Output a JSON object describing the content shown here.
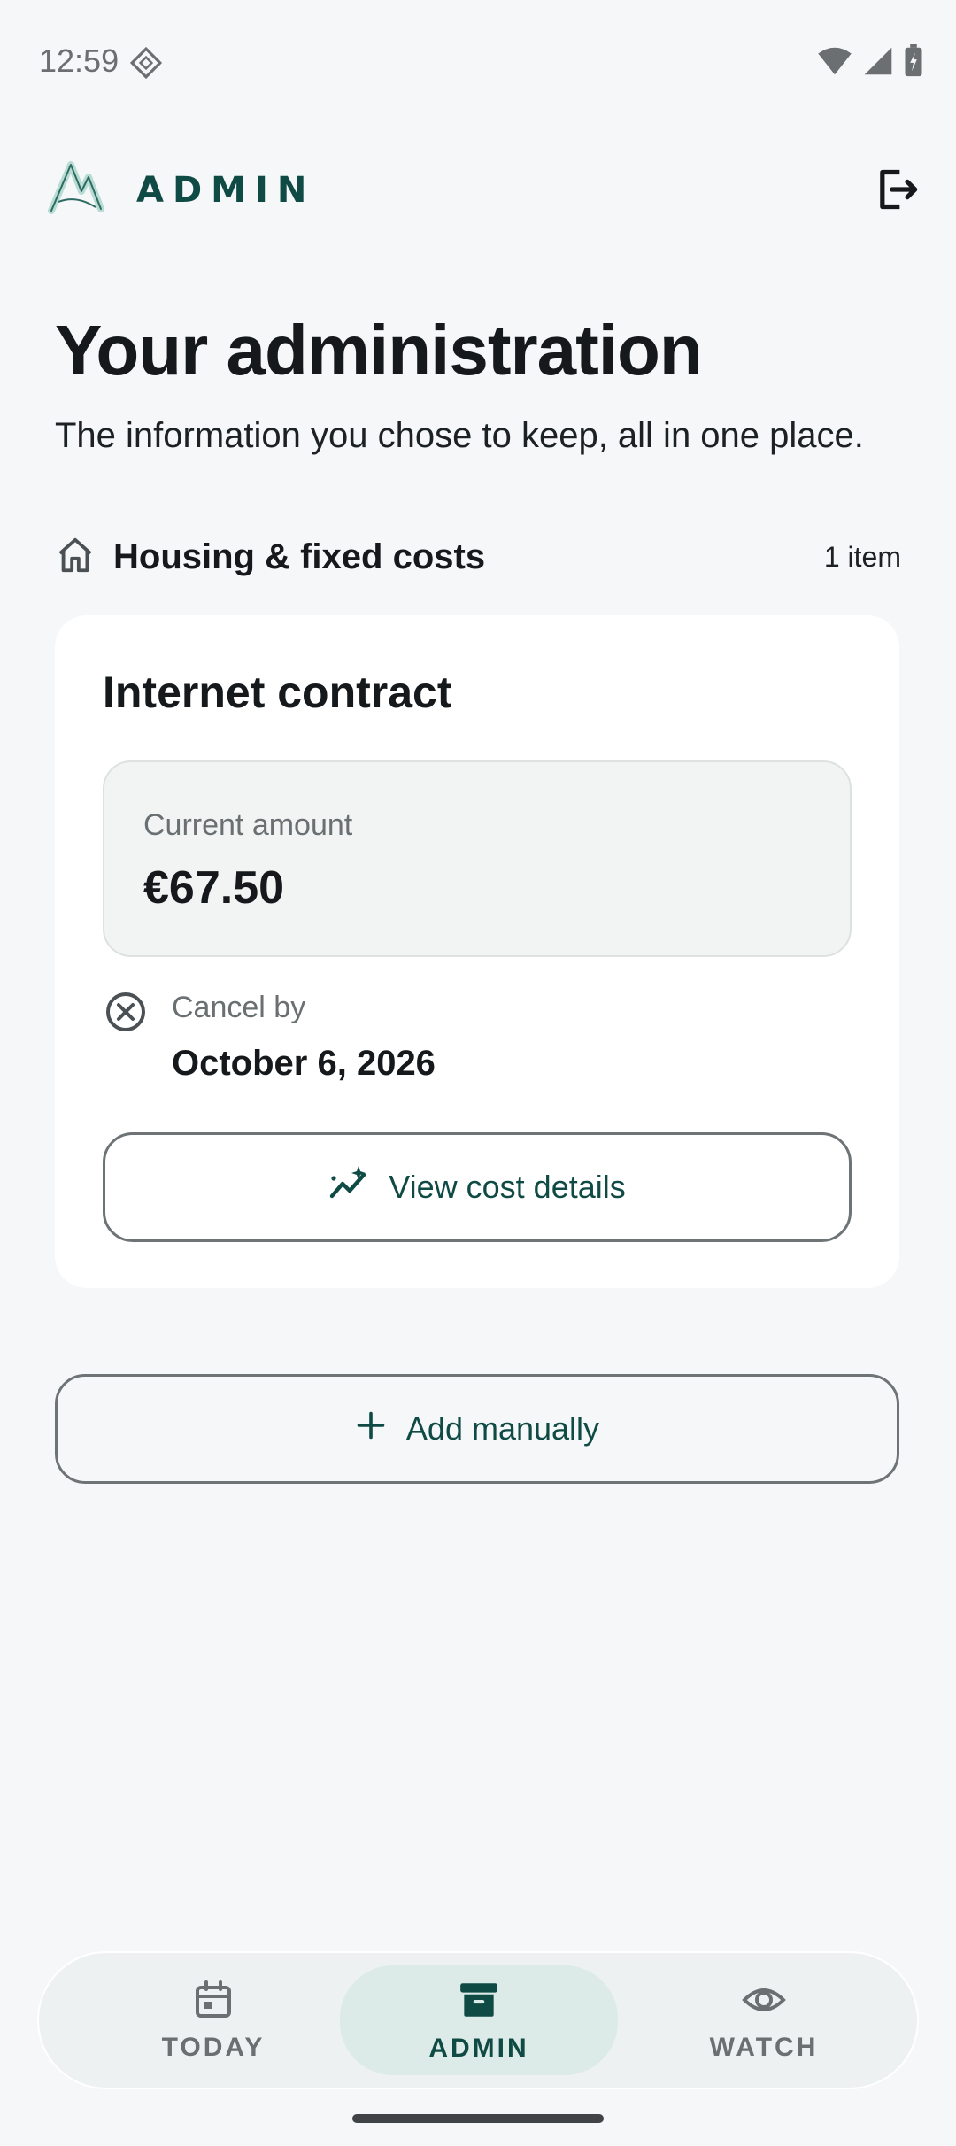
{
  "status_bar": {
    "time": "12:59"
  },
  "header": {
    "title": "ADMIN"
  },
  "page": {
    "title": "Your administration",
    "subtitle": "The information you chose to keep, all in one place."
  },
  "section": {
    "icon": "home-icon",
    "title": "Housing & fixed costs",
    "count": "1 item"
  },
  "card": {
    "title": "Internet contract",
    "amount_label": "Current amount",
    "amount_value": "€67.50",
    "cancel_label": "Cancel by",
    "cancel_date": "October 6, 2026",
    "view_button": "View cost details"
  },
  "add_button": "Add manually",
  "nav": {
    "items": [
      {
        "label": "TODAY",
        "icon": "calendar-icon",
        "active": false
      },
      {
        "label": "ADMIN",
        "icon": "archive-icon",
        "active": true
      },
      {
        "label": "WATCH",
        "icon": "eye-icon",
        "active": false
      }
    ]
  },
  "colors": {
    "background": "#F5F7F9",
    "accent": "#0F4A44",
    "active_nav": "#DCEBE7"
  }
}
